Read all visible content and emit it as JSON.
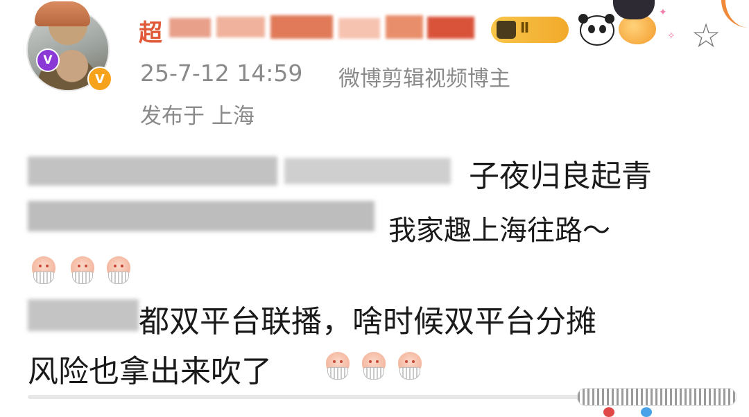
{
  "author": {
    "name_visible_prefix": "超",
    "name_redacted": true,
    "verified_badge": "V",
    "level_badge": "V",
    "crown_level_label": "Ⅱ"
  },
  "meta": {
    "timestamp": "25-7-12 14:59",
    "source": "微博剪辑视频博主",
    "location": "发布于 上海"
  },
  "post": {
    "line1_visible_end": "子夜归良起青",
    "line2_visible_end": "我家趣上海往路～",
    "line4_visible": "都双平台联播，啥时候双平台分摊",
    "line5_visible": "风险也拿出来吹了"
  },
  "icons": {
    "favorite": "☆",
    "accent_orange": "#e05a3a",
    "meta_gray": "#8a8a8a"
  }
}
